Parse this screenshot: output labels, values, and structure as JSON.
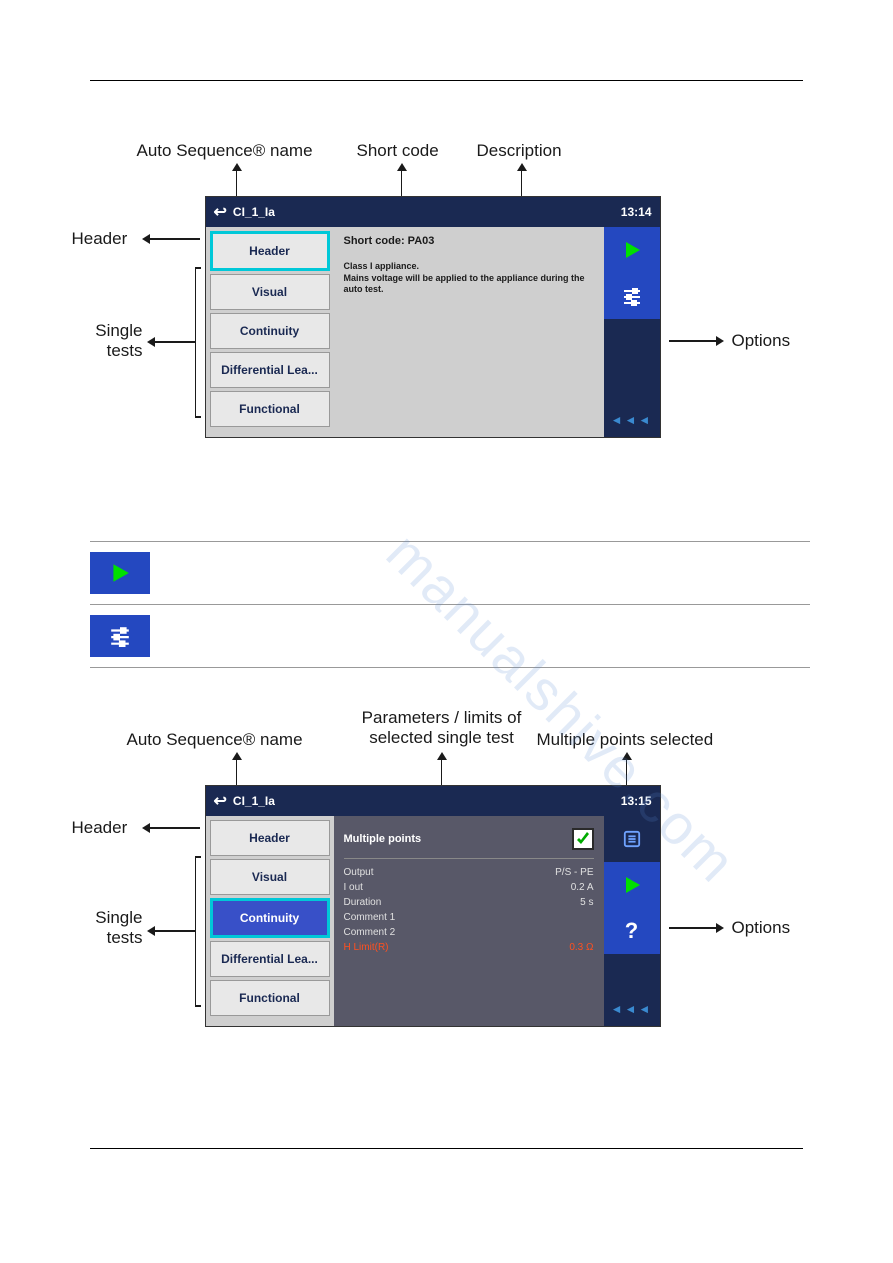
{
  "watermark": "manualshive.com",
  "figure1": {
    "callouts": {
      "top_name": "Auto Sequence® name",
      "top_short": "Short code",
      "top_desc": "Description",
      "left_header": "Header",
      "left_tests": "Single tests",
      "right_options": "Options"
    },
    "screen": {
      "title": "CI_1_Ia",
      "time": "13:14",
      "tabs": [
        "Header",
        "Visual",
        "Continuity",
        "Differential Lea...",
        "Functional"
      ],
      "selected_tab": "Header",
      "short_code": "Short code: PA03",
      "description": "Class I appliance.\nMains voltage will be applied to the appliance during the auto test.",
      "rbtn_play": "play-icon",
      "rbtn_sliders": "sliders-icon",
      "chevrons": "◄◄◄"
    }
  },
  "options_icons": {
    "play": "play-icon",
    "sliders": "sliders-icon"
  },
  "figure2": {
    "callouts": {
      "top_name": "Auto Sequence® name",
      "top_params": "Parameters / limits of selected single test",
      "top_multi": "Multiple points selected",
      "left_header": "Header",
      "left_tests": "Single tests",
      "right_options": "Options"
    },
    "screen": {
      "title": "CI_1_Ia",
      "time": "13:15",
      "tabs": [
        "Header",
        "Visual",
        "Continuity",
        "Differential Lea...",
        "Functional"
      ],
      "selected_tab": "Continuity",
      "multiple_points_label": "Multiple points",
      "params": [
        {
          "k": "Output",
          "v": "P/S - PE"
        },
        {
          "k": "I out",
          "v": "0.2 A"
        },
        {
          "k": "Duration",
          "v": "5 s"
        },
        {
          "k": "Comment 1",
          "v": ""
        },
        {
          "k": "Comment 2",
          "v": ""
        }
      ],
      "limit": {
        "k": "H Limit(R)",
        "v": "0.3 Ω"
      },
      "rbtn_list": "list-icon",
      "rbtn_play": "play-icon",
      "rbtn_help": "?",
      "chevrons": "◄◄◄"
    }
  }
}
